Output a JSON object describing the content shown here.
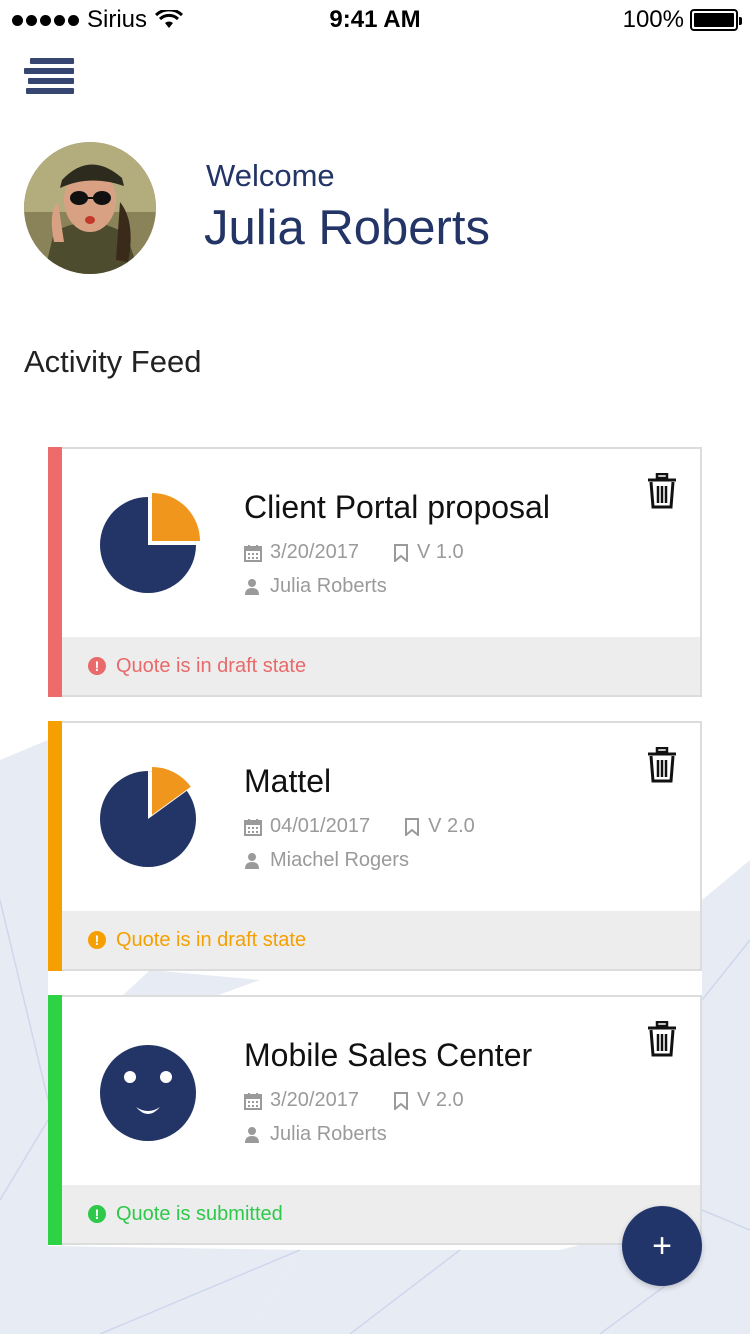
{
  "status_bar": {
    "carrier": "Sirius",
    "time": "9:41 AM",
    "battery": "100%"
  },
  "header": {
    "menu_icon": "hamburger-menu-icon",
    "welcome": "Welcome",
    "user_name": "Julia Roberts"
  },
  "feed": {
    "title": "Activity Feed",
    "items": [
      {
        "title": "Client Portal proposal",
        "date": "3/20/2017",
        "version": "V 1.0",
        "owner": "Julia Roberts",
        "status": "Quote is in draft state",
        "status_color": "#e86a6a",
        "accent_color": "#ee6b6b",
        "icon": "pie-chart-icon",
        "progress_fraction": 0.75
      },
      {
        "title": "Mattel",
        "date": "04/01/2017",
        "version": "V 2.0",
        "owner": "Miachel Rogers",
        "status": "Quote is in draft state",
        "status_color": "#f5a000",
        "accent_color": "#f5a000",
        "icon": "pie-chart-icon",
        "progress_fraction": 0.85
      },
      {
        "title": "Mobile Sales Center",
        "date": "3/20/2017",
        "version": "V 2.0",
        "owner": "Julia Roberts",
        "status": "Quote is submitted",
        "status_color": "#2ec84a",
        "accent_color": "#2ed245",
        "icon": "smiley-face-icon"
      }
    ]
  },
  "fab": {
    "label": "+",
    "icon": "plus-icon"
  },
  "colors": {
    "navy": "#233466",
    "pie_slice": "#f0961c"
  }
}
